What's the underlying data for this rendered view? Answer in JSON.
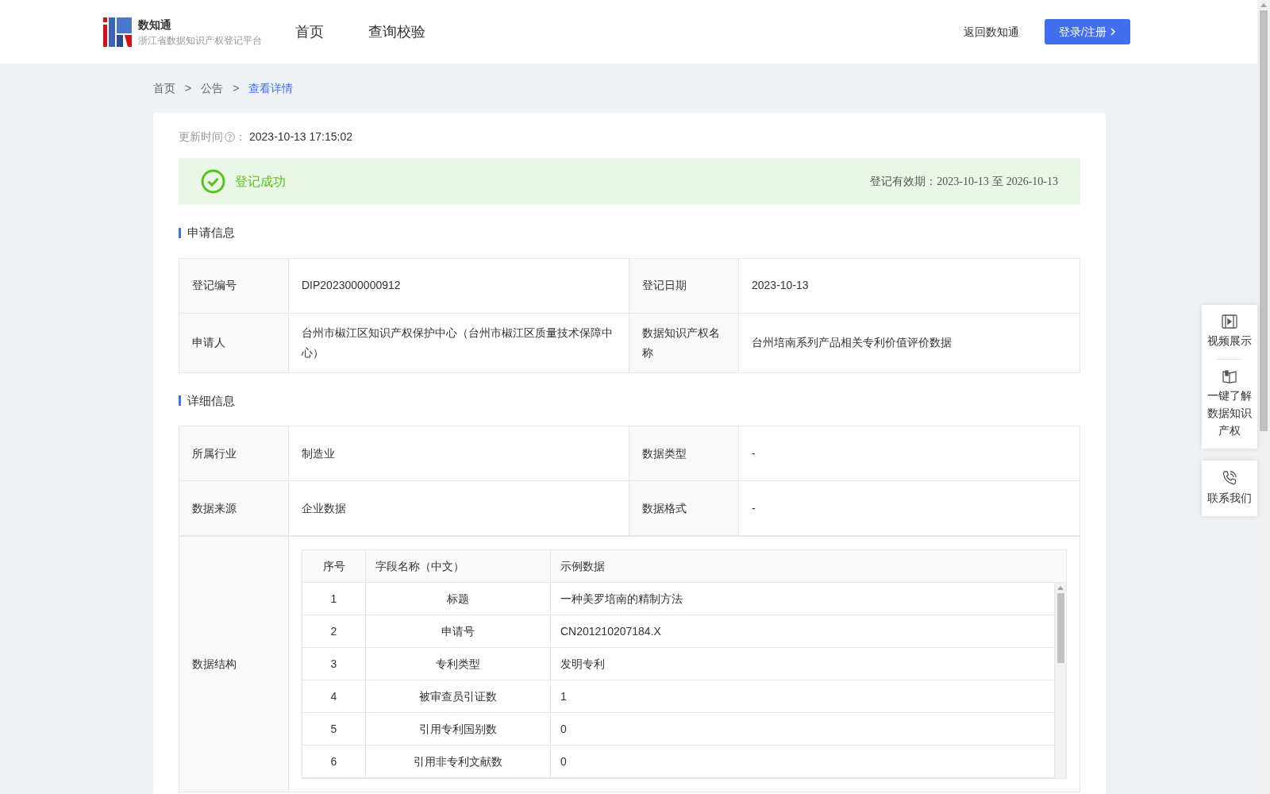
{
  "header": {
    "brand": "数知通",
    "subtitle": "浙江省数据知识产权登记平台",
    "nav": [
      "首页",
      "查询校验"
    ],
    "back_link": "返回数知通",
    "login_button": "登录/注册"
  },
  "breadcrumb": [
    {
      "label": "首页",
      "current": false
    },
    {
      "label": "公告",
      "current": false
    },
    {
      "label": "查看详情",
      "current": true
    }
  ],
  "breadcrumb_separator": ">",
  "update_time": {
    "label": "更新时间",
    "colon": "：",
    "value": "2023-10-13 17:15:02"
  },
  "status_banner": {
    "status": "登记成功",
    "validity_label": "登记有效期：",
    "validity_from": "2023-10-13",
    "validity_to_word": "至",
    "validity_to": "2026-10-13"
  },
  "application_info": {
    "title": "申请信息",
    "rows": [
      {
        "label_1": "登记编号",
        "value_1": "DIP2023000000912",
        "label_2": "登记日期",
        "value_2": "2023-10-13"
      },
      {
        "label_1": "申请人",
        "value_1": "台州市椒江区知识产权保护中心（台州市椒江区质量技术保障中心）",
        "label_2": "数据知识产权名称",
        "value_2": "台州培南系列产品相关专利价值评价数据"
      }
    ]
  },
  "detail_info": {
    "title": "详细信息",
    "rows": [
      {
        "label_1": "所属行业",
        "value_1": "制造业",
        "label_2": "数据类型",
        "value_2": "-"
      },
      {
        "label_1": "数据来源",
        "value_1": "企业数据",
        "label_2": "数据格式",
        "value_2": "-"
      }
    ],
    "structure": {
      "label": "数据结构",
      "columns": [
        "序号",
        "字段名称（中文）",
        "示例数据"
      ],
      "rows": [
        [
          "1",
          "标题",
          "一种美罗培南的精制方法"
        ],
        [
          "2",
          "申请号",
          "CN201210207184.X"
        ],
        [
          "3",
          "专利类型",
          "发明专利"
        ],
        [
          "4",
          "被审查员引证数",
          "1"
        ],
        [
          "5",
          "引用专利国别数",
          "0"
        ],
        [
          "6",
          "引用非专利文献数",
          "0"
        ]
      ]
    }
  },
  "side_panel": [
    {
      "kind": "video",
      "label": "视频展示"
    },
    {
      "kind": "book",
      "label": "一键了解数据知识产权"
    },
    {
      "kind": "phone",
      "label": "联系我们"
    }
  ]
}
